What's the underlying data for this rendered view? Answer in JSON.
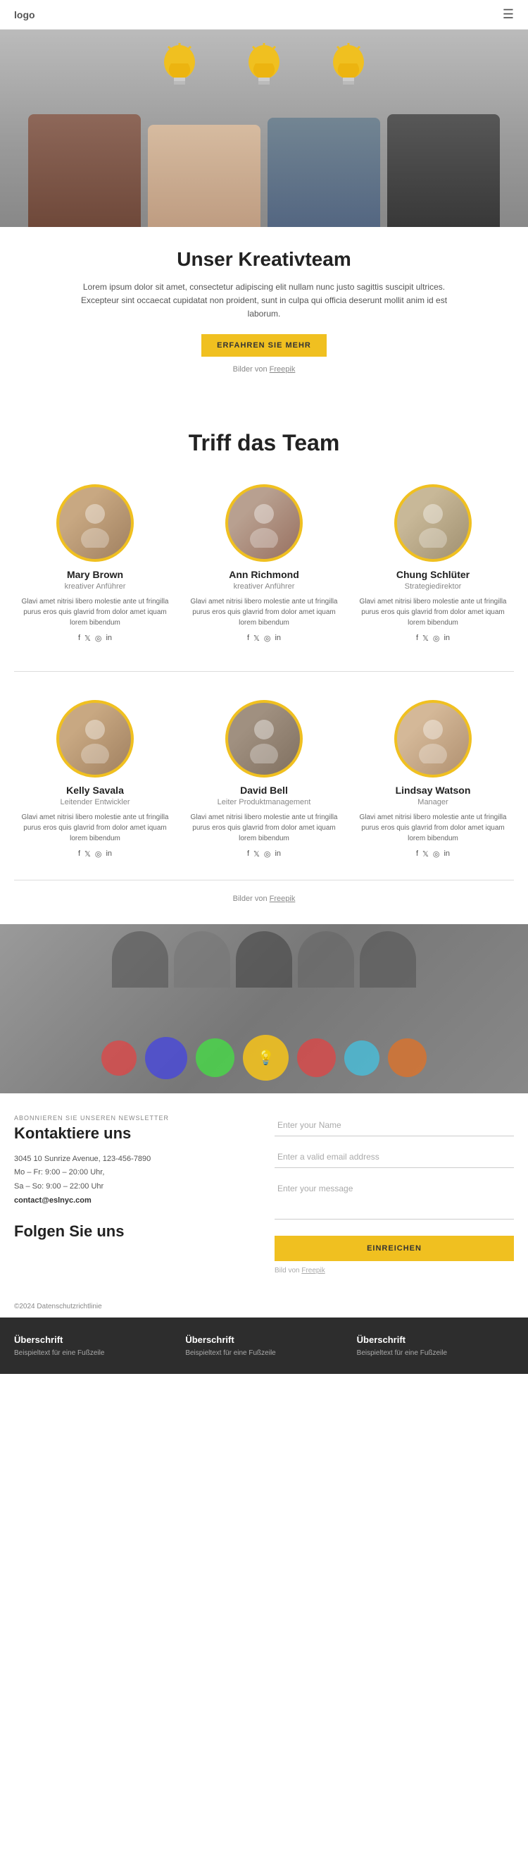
{
  "header": {
    "logo": "logo",
    "menu_icon": "☰"
  },
  "hero": {
    "bulbs": [
      "💡",
      "💡",
      "💡"
    ],
    "alt": "Team holding light bulbs"
  },
  "intro": {
    "title": "Unser Kreativteam",
    "body": "Lorem ipsum dolor sit amet, consectetur adipiscing elit nullam nunc justo sagittis suscipit ultrices. Excepteur sint occaecat cupidatat non proident, sunt in culpa qui officia deserunt mollit anim id est laborum.",
    "button": "ERFAHREN SIE MEHR",
    "credit_prefix": "Bilder von",
    "credit_link": "Freepik"
  },
  "team_section": {
    "title": "Triff das Team",
    "members": [
      {
        "name": "Mary Brown",
        "role": "kreativer Anführer",
        "desc": "Glavi amet nitrisi libero molestie ante ut fringilla purus eros quis glavrid from dolor amet iquam lorem bibendum",
        "avatar_class": "avatar-1"
      },
      {
        "name": "Ann Richmond",
        "role": "kreativer Anführer",
        "desc": "Glavi amet nitrisi libero molestie ante ut fringilla purus eros quis glavrid from dolor amet iquam lorem bibendum",
        "avatar_class": "avatar-2"
      },
      {
        "name": "Chung Schlüter",
        "role": "Strategiedirektor",
        "desc": "Glavi amet nitrisi libero molestie ante ut fringilla purus eros quis glavrid from dolor amet iquam lorem bibendum",
        "avatar_class": "avatar-3"
      },
      {
        "name": "Kelly Savala",
        "role": "Leitender Entwickler",
        "desc": "Glavi amet nitrisi libero molestie ante ut fringilla purus eros quis glavrid from dolor amet iquam lorem bibendum",
        "avatar_class": "avatar-4"
      },
      {
        "name": "David Bell",
        "role": "Leiter Produktmanagement",
        "desc": "Glavi amet nitrisi libero molestie ante ut fringilla purus eros quis glavrid from dolor amet iquam lorem bibendum",
        "avatar_class": "avatar-5"
      },
      {
        "name": "Lindsay Watson",
        "role": "Manager",
        "desc": "Glavi amet nitrisi libero molestie ante ut fringilla purus eros quis glavrid from dolor amet iquam lorem bibendum",
        "avatar_class": "avatar-6"
      }
    ],
    "social_icons": [
      "f",
      "𝕏",
      "📷",
      "in"
    ],
    "credit_prefix": "Bilder von",
    "credit_link": "Freepik"
  },
  "contact": {
    "newsletter_label": "ABONNIEREN SIE UNSEREN NEWSLETTER",
    "title": "Kontaktiere uns",
    "address": "3045 10 Sunrize Avenue, 123-456-7890",
    "hours1": "Mo – Fr: 9:00 – 20:00 Uhr,",
    "hours2": "Sa – So: 9:00 – 22:00 Uhr",
    "email": "contact@eslnyc.com",
    "follow_title": "Folgen Sie uns",
    "form": {
      "name_placeholder": "Enter your Name",
      "email_placeholder": "Enter a valid email address",
      "message_placeholder": "Enter your message",
      "submit_button": "EINREICHEN",
      "credit_prefix": "Bild von",
      "credit_link": "Freepik"
    }
  },
  "copyright": {
    "text": "©2024",
    "link": "Datenschutzrichtlinie"
  },
  "footer": {
    "columns": [
      {
        "title": "Überschrift",
        "body": "Beispieltext für eine Fußzeile"
      },
      {
        "title": "Überschrift",
        "body": "Beispieltext für eine Fußzeile"
      },
      {
        "title": "Überschrift",
        "body": "Beispieltext für eine Fußzeile"
      }
    ]
  }
}
